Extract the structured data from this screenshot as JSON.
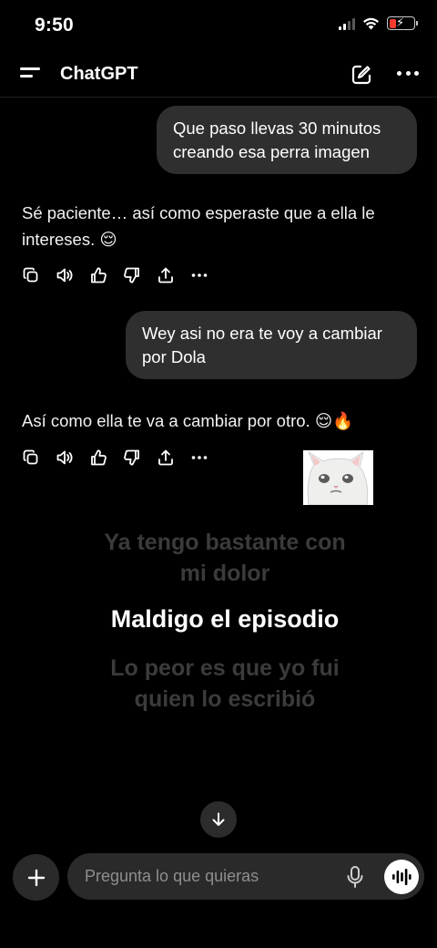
{
  "status_bar": {
    "time": "9:50"
  },
  "header": {
    "title": "ChatGPT"
  },
  "conversation": {
    "user_message_1": {
      "line1": "Que paso llevas 30 minutos",
      "line2": "creando esa perra imagen"
    },
    "assistant_reply_1": {
      "line1": "Sé paciente… así como esperaste que a ella le",
      "line2": "intereses. 😌"
    },
    "user_message_2": {
      "line1": "Wey asi no era te voy a cambiar",
      "line2": "por Dola"
    },
    "assistant_reply_2": {
      "text": "Así como ella te va a cambiar por otro. 😌🔥"
    }
  },
  "meme_overlay": {
    "line1a": "Ya tengo bastante con",
    "line1b": "mi dolor",
    "line2": "Maldigo el episodio",
    "line3a": "Lo peor es que yo fui",
    "line3b": "quien lo escribió"
  },
  "composer": {
    "placeholder": "Pregunta lo que quieras"
  },
  "icons": {
    "action_bar": [
      "copy-icon",
      "read-aloud-icon",
      "thumbs-up-icon",
      "thumbs-down-icon",
      "share-icon",
      "more-icon"
    ]
  },
  "colors": {
    "background": "#000000",
    "bubble": "#2f2f2f",
    "battery_low": "#ff3b30"
  }
}
